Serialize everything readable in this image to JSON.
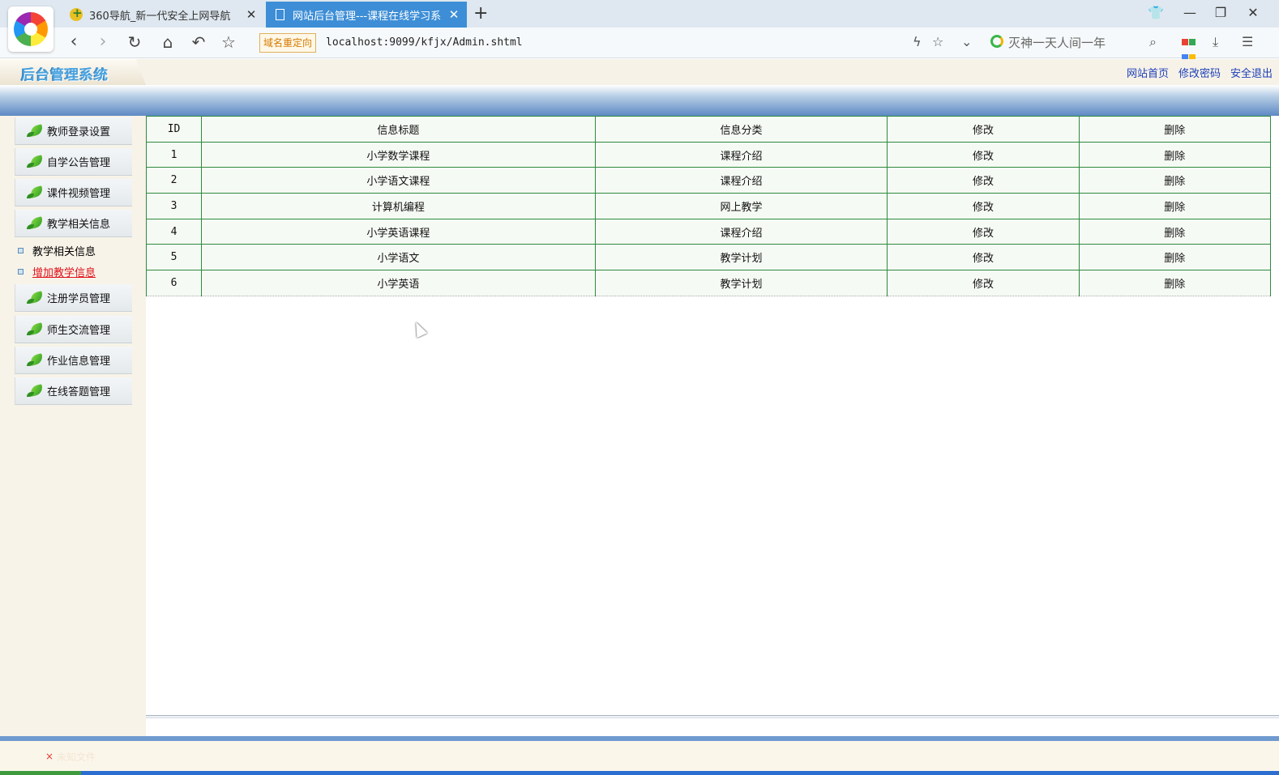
{
  "browser": {
    "tabs": [
      {
        "title": "360导航_新一代安全上网导航",
        "close": "✕"
      },
      {
        "title": "网站后台管理---课程在线学习系",
        "close": "✕"
      }
    ],
    "new_tab": "+",
    "redirect_badge": "域名重定向",
    "url": "localhost:9099/kfjx/Admin.shtml",
    "search_text": "灭神一天人间一年"
  },
  "site": {
    "logo_text": "后台管理系统",
    "header_links": [
      "网站首页",
      "修改密码",
      "安全退出"
    ]
  },
  "sidebar": {
    "items": [
      {
        "label": "教师登录设置"
      },
      {
        "label": "自学公告管理"
      },
      {
        "label": "课件视频管理"
      },
      {
        "label": "教学相关信息"
      },
      {
        "label": "注册学员管理"
      },
      {
        "label": "师生交流管理"
      },
      {
        "label": "作业信息管理"
      },
      {
        "label": "在线答题管理"
      }
    ],
    "sub_items": [
      {
        "label": "教学相关信息",
        "active": false
      },
      {
        "label": "增加教学信息",
        "active": true
      }
    ]
  },
  "table": {
    "headers": [
      "ID",
      "信息标题",
      "信息分类",
      "修改",
      "删除"
    ],
    "rows": [
      {
        "id": "1",
        "title": "小学数学课程",
        "category": "课程介绍",
        "edit": "修改",
        "delete": "删除"
      },
      {
        "id": "2",
        "title": "小学语文课程",
        "category": "课程介绍",
        "edit": "修改",
        "delete": "删除"
      },
      {
        "id": "3",
        "title": "计算机编程",
        "category": "网上教学",
        "edit": "修改",
        "delete": "删除"
      },
      {
        "id": "4",
        "title": "小学英语课程",
        "category": "课程介绍",
        "edit": "修改",
        "delete": "删除"
      },
      {
        "id": "5",
        "title": "小学语文",
        "category": "教学计划",
        "edit": "修改",
        "delete": "删除"
      },
      {
        "id": "6",
        "title": "小学英语",
        "category": "教学计划",
        "edit": "修改",
        "delete": "删除"
      }
    ]
  },
  "footer": {
    "close_mark": "×",
    "faint_text": "未知文件"
  },
  "colors": {
    "active_tab": "#3d8ed6",
    "table_border": "#2e8b3e",
    "header_link": "#1b3fb8",
    "active_sub_link": "#e0101a",
    "band_blue": "#5e89c4"
  }
}
